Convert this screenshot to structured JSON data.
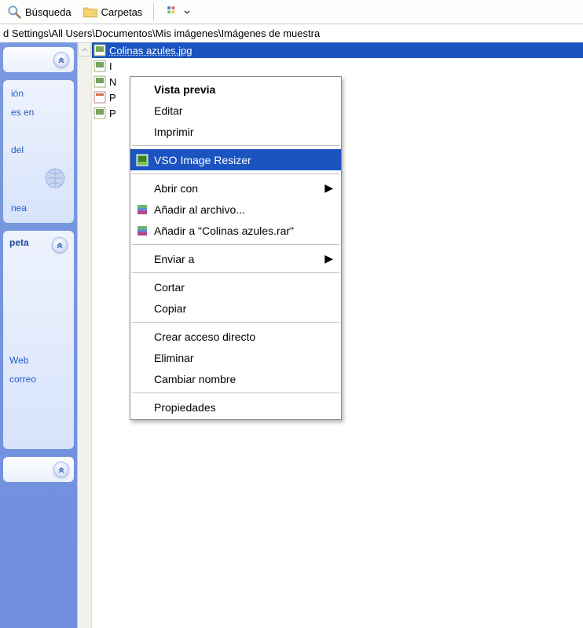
{
  "toolbar": {
    "search_label": "Búsqueda",
    "folders_label": "Carpetas"
  },
  "address_path": "d Settings\\All Users\\Documentos\\Mis imágenes\\Imágenes de muestra",
  "files": [
    {
      "name": "Colinas azules.jpg",
      "selected": true
    },
    {
      "name": "I"
    },
    {
      "name": "N"
    },
    {
      "name": "P"
    },
    {
      "name": "P"
    }
  ],
  "sidebar": {
    "panel1": {
      "items": [
        "ión",
        "es en"
      ],
      "items2": [
        "del"
      ],
      "items3": [
        "nea"
      ]
    },
    "panel2": {
      "title": "peta",
      "items": [
        "Web",
        "correo"
      ]
    }
  },
  "context_menu": {
    "preview": "Vista previa",
    "edit": "Editar",
    "print": "Imprimir",
    "vso": "VSO Image Resizer",
    "open_with": "Abrir con",
    "add_archive": "Añadir al archivo...",
    "add_to_rar": "Añadir a \"Colinas azules.rar\"",
    "send_to": "Enviar a",
    "cut": "Cortar",
    "copy": "Copiar",
    "create_shortcut": "Crear acceso directo",
    "delete": "Eliminar",
    "rename": "Cambiar nombre",
    "properties": "Propiedades"
  }
}
